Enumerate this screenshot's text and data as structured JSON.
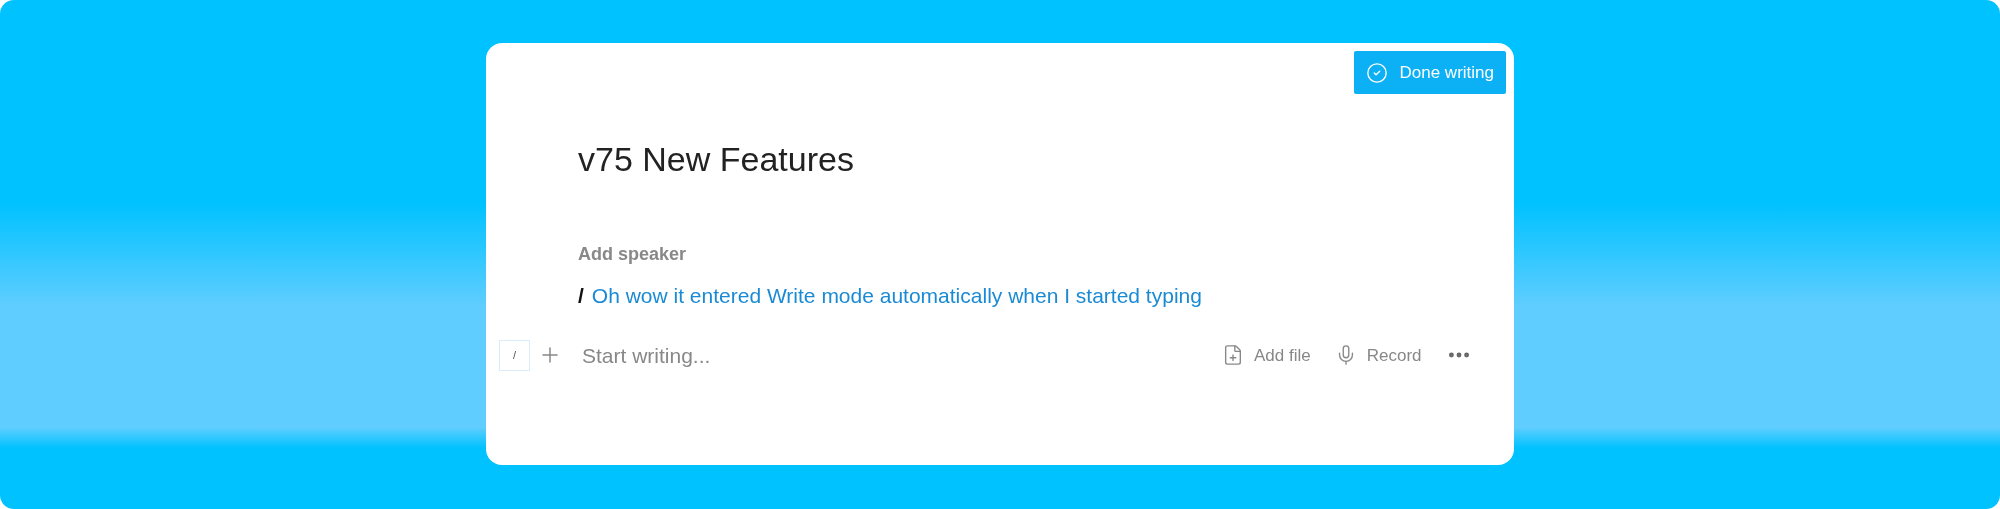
{
  "done_button": {
    "label": "Done writing"
  },
  "title": "v75 New Features",
  "speaker": {
    "label": "Add speaker"
  },
  "entry": {
    "marker": "/",
    "text": "Oh wow it entered Write mode automatically when I started typing"
  },
  "composer": {
    "shortcut_key": "/",
    "placeholder": "Start writing...",
    "actions": [
      {
        "kind": "file",
        "label": "Add file"
      },
      {
        "kind": "record",
        "label": "Record"
      }
    ]
  }
}
